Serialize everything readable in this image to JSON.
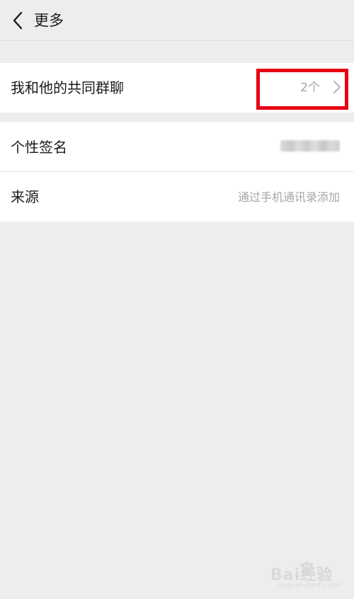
{
  "header": {
    "back_icon": "chevron-left-icon",
    "title": "更多"
  },
  "rows": {
    "common_groups": {
      "label": "我和他的共同群聊",
      "value": "2个",
      "icon": "chevron-right-icon",
      "highlight_color": "#e60012"
    },
    "signature": {
      "label": "个性签名",
      "value_note": "blurred"
    },
    "source": {
      "label": "来源",
      "value": "通过手机通讯录添加"
    }
  },
  "watermark": {
    "text": "Bai经验",
    "sub": "jingyan.baidu.com"
  },
  "colors": {
    "background": "#ededed",
    "row_background": "#ffffff",
    "text_primary": "#1a1a1a",
    "text_secondary": "#a6a6a6"
  }
}
